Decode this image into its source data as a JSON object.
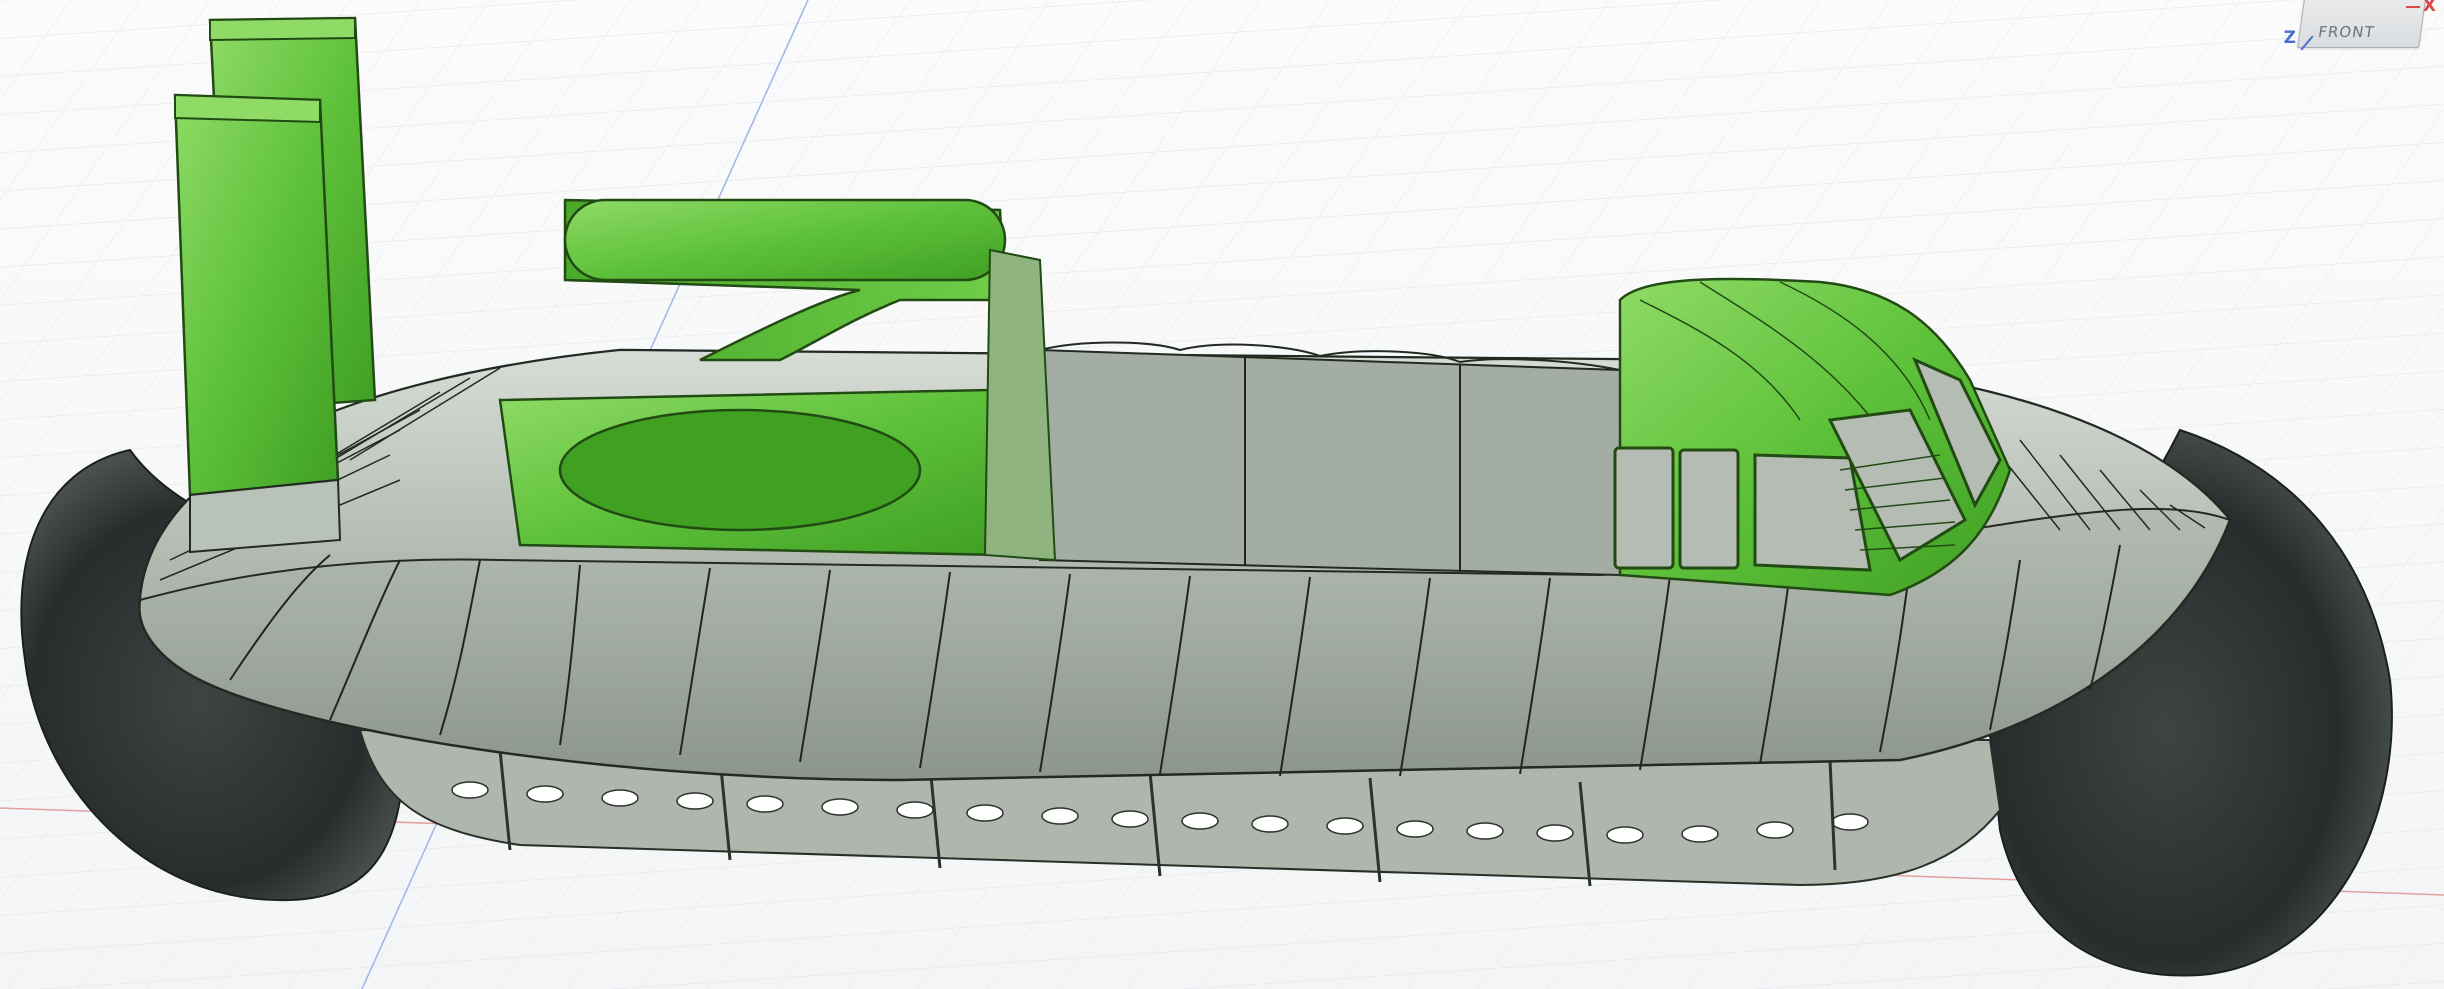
{
  "viewcube": {
    "face_label": "FRONT",
    "axes": {
      "x": "X",
      "z": "Z"
    }
  },
  "colors": {
    "background": "#f7f8f9",
    "grid_line": "#dfe2e6",
    "axis_red": "#d7494a",
    "axis_blue": "#4a6fd0",
    "selected_body": "#5ec13a",
    "hull_gray": "#a8b1a8",
    "skirt_dark": "#2d3332"
  }
}
